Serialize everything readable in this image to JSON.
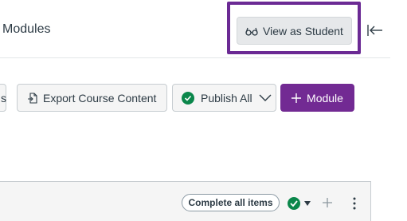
{
  "header": {
    "title": "Modules",
    "view_as_student_label": "View as Student"
  },
  "toolbar": {
    "partial_label": "s",
    "export_label": "Export Course Content",
    "publish_all_label": "Publish All",
    "module_label": "Module"
  },
  "module_row": {
    "complete_all_label": "Complete all items"
  },
  "colors": {
    "highlight_border": "#6b2a94",
    "module_button": "#722a93",
    "publish_green": "#0b874b"
  },
  "icons": {
    "view_student": "glasses-icon",
    "collapse": "collapse-sidebar-icon",
    "export": "export-icon",
    "publish": "green-check-icon",
    "dropdown": "chevron-down-icon",
    "add_module": "plus-icon",
    "row_publish": "green-check-icon",
    "row_caret": "caret-down-icon",
    "row_add": "plus-icon",
    "row_menu": "kebab-menu-icon"
  }
}
